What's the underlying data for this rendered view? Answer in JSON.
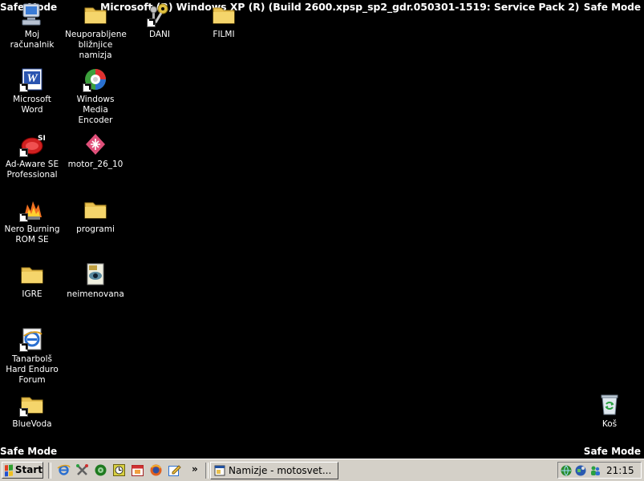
{
  "safe_mode_label": "Safe Mode",
  "build_title": "Microsoft (R) Windows XP (R) (Build 2600.xpsp_sp2_gdr.050301-1519: Service Pack 2)",
  "desktop_icons": [
    {
      "label": "Moj računalnik"
    },
    {
      "label": "Neuporabljene bližnjice namizja"
    },
    {
      "label": "DANI"
    },
    {
      "label": "FILMI"
    },
    {
      "label": "Microsoft Word"
    },
    {
      "label": "Windows Media Encoder"
    },
    {
      "label": "Ad-Aware SE Professional"
    },
    {
      "label": "motor_26_10"
    },
    {
      "label": "Nero Burning ROM SE"
    },
    {
      "label": "programi"
    },
    {
      "label": "IGRE"
    },
    {
      "label": "neimenovana"
    },
    {
      "label": "Tanarbolš Hard Enduro Forum"
    },
    {
      "label": "BlueVoda"
    },
    {
      "label": "Koš"
    }
  ],
  "taskbar": {
    "start_label": "Start",
    "more_label": "»",
    "task_label": "Namizje - motosvet...",
    "clock": "21:15"
  },
  "colors": {
    "desktop": "#000000",
    "taskbar": "#d4d0c8",
    "folder": "#f5d56b"
  }
}
